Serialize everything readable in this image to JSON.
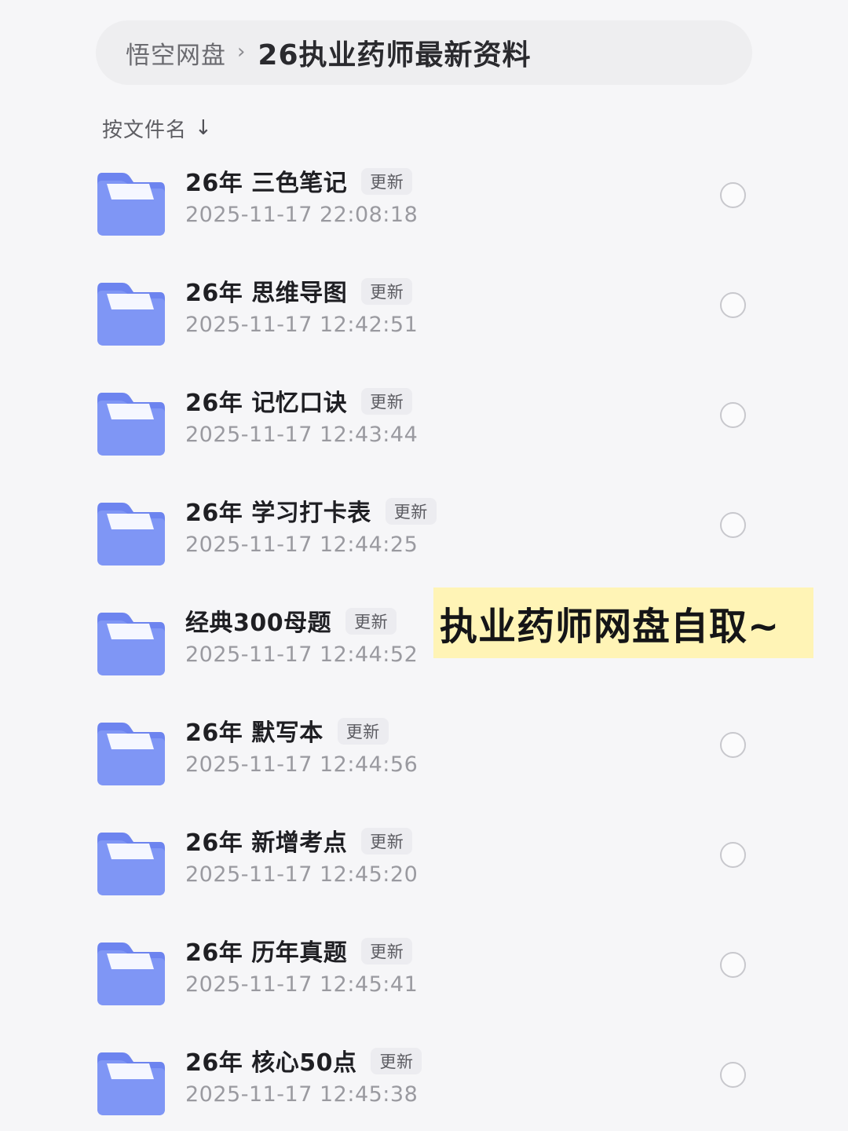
{
  "breadcrumb": {
    "root": "悟空网盘",
    "separator": "›",
    "current": "26执业药师最新资料"
  },
  "sort": {
    "label": "按文件名",
    "arrow": "↓"
  },
  "files": [
    {
      "name": "26年 三色笔记",
      "badge": "更新",
      "time": "2025-11-17 22:08:18"
    },
    {
      "name": "26年 思维导图",
      "badge": "更新",
      "time": "2025-11-17 12:42:51"
    },
    {
      "name": "26年 记忆口诀",
      "badge": "更新",
      "time": "2025-11-17 12:43:44"
    },
    {
      "name": "26年 学习打卡表",
      "badge": "更新",
      "time": "2025-11-17 12:44:25"
    },
    {
      "name": "经典300母题",
      "badge": "更新",
      "time": "2025-11-17 12:44:52"
    },
    {
      "name": "26年 默写本",
      "badge": "更新",
      "time": "2025-11-17 12:44:56"
    },
    {
      "name": "26年 新增考点",
      "badge": "更新",
      "time": "2025-11-17 12:45:20"
    },
    {
      "name": "26年 历年真题",
      "badge": "更新",
      "time": "2025-11-17 12:45:41"
    },
    {
      "name": "26年 核心50点",
      "badge": "更新",
      "time": "2025-11-17 12:45:38"
    }
  ],
  "overlay": {
    "text": "执业药师网盘自取~"
  },
  "colors": {
    "folder_front": "#7f96f5",
    "folder_back": "#6d84ef",
    "overlay_bg": "#fff4b6"
  },
  "icons": {
    "folder": "folder-icon",
    "radio": "radio-circle-icon",
    "chevron": "chevron-right-icon",
    "sort": "arrow-down-icon"
  }
}
